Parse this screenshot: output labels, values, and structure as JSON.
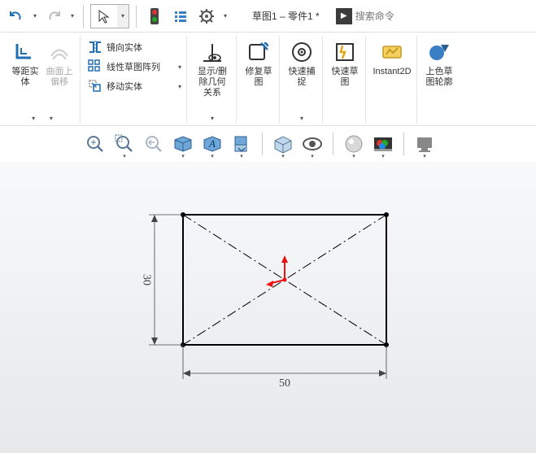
{
  "doc_title": "草图1 – 零件1 *",
  "search": {
    "placeholder": "搜索命令"
  },
  "ribbon": {
    "offset": "等距实\n体",
    "surface_offset": "曲面上\n偏移",
    "mirror": "镜向实体",
    "linear_pattern": "线性草图阵列",
    "move": "移动实体",
    "show_relations": "显示/删\n除几何\n关系",
    "repair": "修复草\n图",
    "quick_snap": "快速捕\n捉",
    "rapid_sketch": "快速草\n图",
    "instant2d": "Instant2D",
    "shaded": "上色草\n图轮廓"
  },
  "dims": {
    "width": "50",
    "height": "30"
  }
}
